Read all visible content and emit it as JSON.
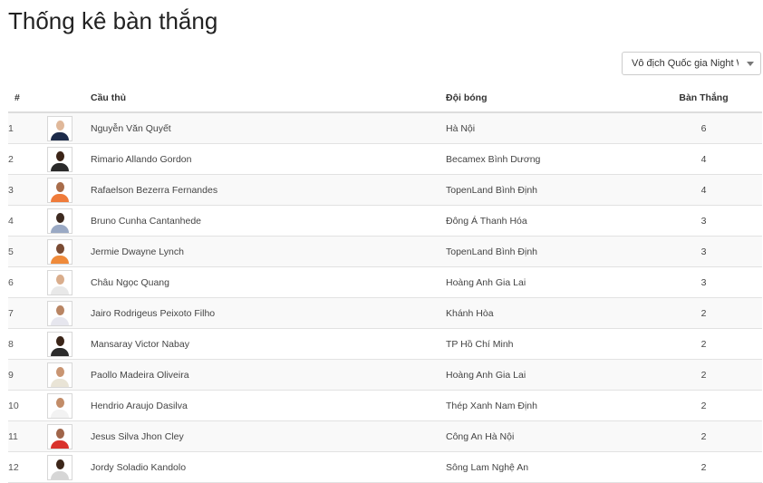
{
  "page": {
    "title": "Thống kê bàn thắng"
  },
  "filter": {
    "selected": "Vô địch Quốc gia Night W..."
  },
  "table": {
    "headers": {
      "rank": "#",
      "player": "Cầu thủ",
      "club": "Đội bóng",
      "goals": "Bàn Thắng"
    },
    "rows": [
      {
        "rank": "1",
        "player": "Nguyễn Văn Quyết",
        "club": "Hà Nội",
        "goals": "6"
      },
      {
        "rank": "2",
        "player": "Rimario Allando Gordon",
        "club": "Becamex Bình Dương",
        "goals": "4"
      },
      {
        "rank": "3",
        "player": "Rafaelson Bezerra Fernandes",
        "club": "TopenLand Bình Định",
        "goals": "4"
      },
      {
        "rank": "4",
        "player": "Bruno Cunha Cantanhede",
        "club": "Đông Á Thanh Hóa",
        "goals": "3"
      },
      {
        "rank": "5",
        "player": "Jermie Dwayne Lynch",
        "club": "TopenLand Bình Định",
        "goals": "3"
      },
      {
        "rank": "6",
        "player": "Châu Ngọc Quang",
        "club": "Hoàng Anh Gia Lai",
        "goals": "3"
      },
      {
        "rank": "7",
        "player": "Jairo Rodrigeus Peixoto Filho",
        "club": "Khánh Hòa",
        "goals": "2"
      },
      {
        "rank": "8",
        "player": "Mansaray Victor Nabay",
        "club": "TP Hồ Chí Minh",
        "goals": "2"
      },
      {
        "rank": "9",
        "player": "Paollo Madeira Oliveira",
        "club": "Hoàng Anh Gia Lai",
        "goals": "2"
      },
      {
        "rank": "10",
        "player": "Hendrio Araujo Dasilva",
        "club": "Thép Xanh Nam Định",
        "goals": "2"
      },
      {
        "rank": "11",
        "player": "Jesus Silva Jhon Cley",
        "club": "Công An Hà Nội",
        "goals": "2"
      },
      {
        "rank": "12",
        "player": "Jordy Soladio Kandolo",
        "club": "Sông Lam Nghệ An",
        "goals": "2"
      }
    ]
  },
  "avatars": [
    {
      "skin": "#e0b89a",
      "shirt": "#1c2b4a"
    },
    {
      "skin": "#3b2417",
      "shirt": "#2a2a2a"
    },
    {
      "skin": "#a86c4a",
      "shirt": "#ef7b3a"
    },
    {
      "skin": "#3d2a20",
      "shirt": "#9aa9c4"
    },
    {
      "skin": "#7a4b33",
      "shirt": "#ef8a3a"
    },
    {
      "skin": "#d9ad8c",
      "shirt": "#e8e8e8"
    },
    {
      "skin": "#b98563",
      "shirt": "#e6e6ee"
    },
    {
      "skin": "#3a2418",
      "shirt": "#2b2b2b"
    },
    {
      "skin": "#c99572",
      "shirt": "#e9e4d6"
    },
    {
      "skin": "#c28c68",
      "shirt": "#f2f2f2"
    },
    {
      "skin": "#a0654a",
      "shirt": "#d9322c"
    },
    {
      "skin": "#3c2619",
      "shirt": "#d6d6d6"
    }
  ]
}
